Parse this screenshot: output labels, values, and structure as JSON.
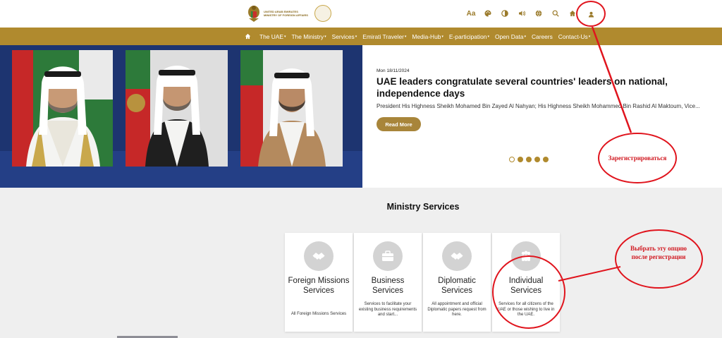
{
  "header": {
    "logo_lines": [
      "UNITED ARAB EMIRATES",
      "MINISTRY OF FOREIGN AFFAIRS"
    ],
    "tools": [
      {
        "name": "font-size-icon",
        "glyph": "Aa"
      },
      {
        "name": "palette-icon",
        "glyph": ""
      },
      {
        "name": "contrast-icon",
        "glyph": ""
      },
      {
        "name": "speaker-icon",
        "glyph": ""
      },
      {
        "name": "globe-icon",
        "glyph": ""
      },
      {
        "name": "search-icon",
        "glyph": ""
      },
      {
        "name": "home-icon",
        "glyph": ""
      },
      {
        "name": "user-icon",
        "glyph": ""
      }
    ]
  },
  "nav": {
    "items": [
      {
        "label": "The UAE",
        "dropdown": true
      },
      {
        "label": "The Ministry",
        "dropdown": true
      },
      {
        "label": "Services",
        "dropdown": true
      },
      {
        "label": "Emirati Traveler",
        "dropdown": true
      },
      {
        "label": "Media-Hub",
        "dropdown": true
      },
      {
        "label": "E-participation",
        "dropdown": true
      },
      {
        "label": "Open Data",
        "dropdown": true
      },
      {
        "label": "Careers",
        "dropdown": false
      },
      {
        "label": "Contact-Us",
        "dropdown": true
      }
    ],
    "caret": "▾"
  },
  "hero": {
    "date": "Mon 18/11/2024",
    "headline": "UAE leaders congratulate several countries' leaders on national, independence days",
    "summary": "President His Highness Sheikh Mohamed Bin Zayed Al Nahyan; His Highness Sheikh Mohammed Bin Rashid Al Maktoum, Vice...",
    "read_more": "Read More",
    "slides_total": 5,
    "slide_active": 1
  },
  "annotations": {
    "register": "Зарегистрироваться",
    "choose_option": "Выбрать эту опцию после регистрации"
  },
  "services": {
    "title": "Ministry Services",
    "cards": [
      {
        "title": "Foreign Missions Services",
        "desc": "All Foreign Missions Services",
        "icon": "handshake-icon"
      },
      {
        "title": "Business Services",
        "desc": "Services to facilitate your existing business requirements and start...",
        "icon": "briefcase-icon"
      },
      {
        "title": "Diplomatic Services",
        "desc": "All appointment and official Diplomatic papers request from here.",
        "icon": "handshake-icon"
      },
      {
        "title": "Individual Services",
        "desc": "Services for all citizens of the UAE or those wishing to live in the UAE.",
        "icon": "people-icon"
      }
    ]
  },
  "colors": {
    "gold": "#b08a2e",
    "hero_blue": "#1d3470",
    "annotation_red": "#e0141d"
  }
}
